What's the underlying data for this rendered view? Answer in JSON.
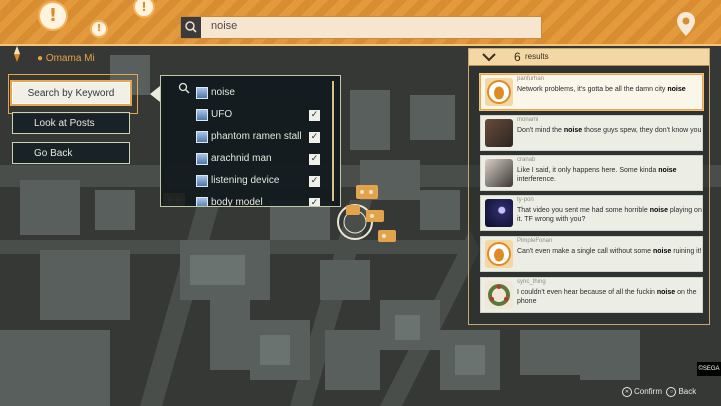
{
  "search": {
    "query": "noise"
  },
  "location": {
    "label": "Omama Mi"
  },
  "menu": {
    "items": [
      {
        "label": "Search by Keyword",
        "active": true
      },
      {
        "label": "Look at Posts",
        "active": false
      },
      {
        "label": "Go Back",
        "active": false
      }
    ]
  },
  "keywords": {
    "query": "noise",
    "items": [
      {
        "label": "UFO",
        "checked": true
      },
      {
        "label": "phantom ramen stall",
        "checked": true
      },
      {
        "label": "arachnid man",
        "checked": true
      },
      {
        "label": "listening device",
        "checked": true
      },
      {
        "label": "body model",
        "checked": true
      }
    ]
  },
  "results": {
    "count": "6",
    "label": "results",
    "posts": [
      {
        "user": "panfurhan",
        "pre": "Network problems, it's gotta be all the damn city ",
        "kw": "noise",
        "post": "",
        "avatar": "egg-icon"
      },
      {
        "user": "monami",
        "pre": "Don't mind the ",
        "kw": "noise",
        "post": " those guys spew, they don't know you",
        "avatar": "photo-avatar"
      },
      {
        "user": "cranab",
        "pre": "Like I said, it only happens here. Some kinda ",
        "kw": "noise",
        "post": " interference.",
        "avatar": "photo-avatar"
      },
      {
        "user": "ty-pon",
        "pre": "That video you sent me had some horrible ",
        "kw": "noise",
        "post": " playing on it. TF wrong with you?",
        "avatar": "space-avatar"
      },
      {
        "user": "PimpleFonan",
        "pre": "Can't even make a single call without some ",
        "kw": "noise",
        "post": " ruining it!",
        "avatar": "egg-icon"
      },
      {
        "user": "sync_thing",
        "pre": "I couldn't even hear because of all the fuckin ",
        "kw": "noise",
        "post": " on the phone",
        "avatar": "wreath-avatar"
      }
    ]
  },
  "footer": {
    "sega": "©SEGA",
    "confirm": "Confirm",
    "back": "Back"
  },
  "colors": {
    "accent": "#e9a54e",
    "header": "#e39a3c",
    "map_dark": "#2a2d2f",
    "road": "#3d4245"
  }
}
